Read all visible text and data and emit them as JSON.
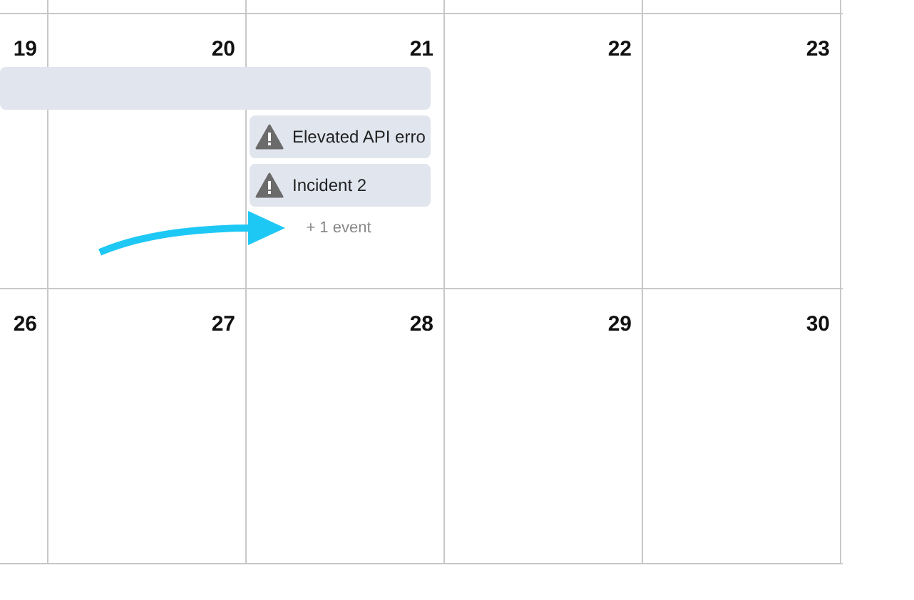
{
  "weeks": [
    {
      "days": [
        {
          "number": "19",
          "bar": true
        },
        {
          "number": "20",
          "bar": true
        },
        {
          "number": "21",
          "bar": true,
          "incidents": [
            {
              "title": "Elevated API erro"
            },
            {
              "title": "Incident 2"
            }
          ],
          "more": "+ 1 event"
        },
        {
          "number": "22",
          "bar": false
        },
        {
          "number": "23",
          "bar": false
        }
      ]
    },
    {
      "days": [
        {
          "number": "26",
          "bar": false
        },
        {
          "number": "27",
          "bar": false
        },
        {
          "number": "28",
          "bar": false
        },
        {
          "number": "29",
          "bar": false
        },
        {
          "number": "30",
          "bar": false
        }
      ]
    }
  ],
  "annotation": {
    "kind": "arrow"
  }
}
